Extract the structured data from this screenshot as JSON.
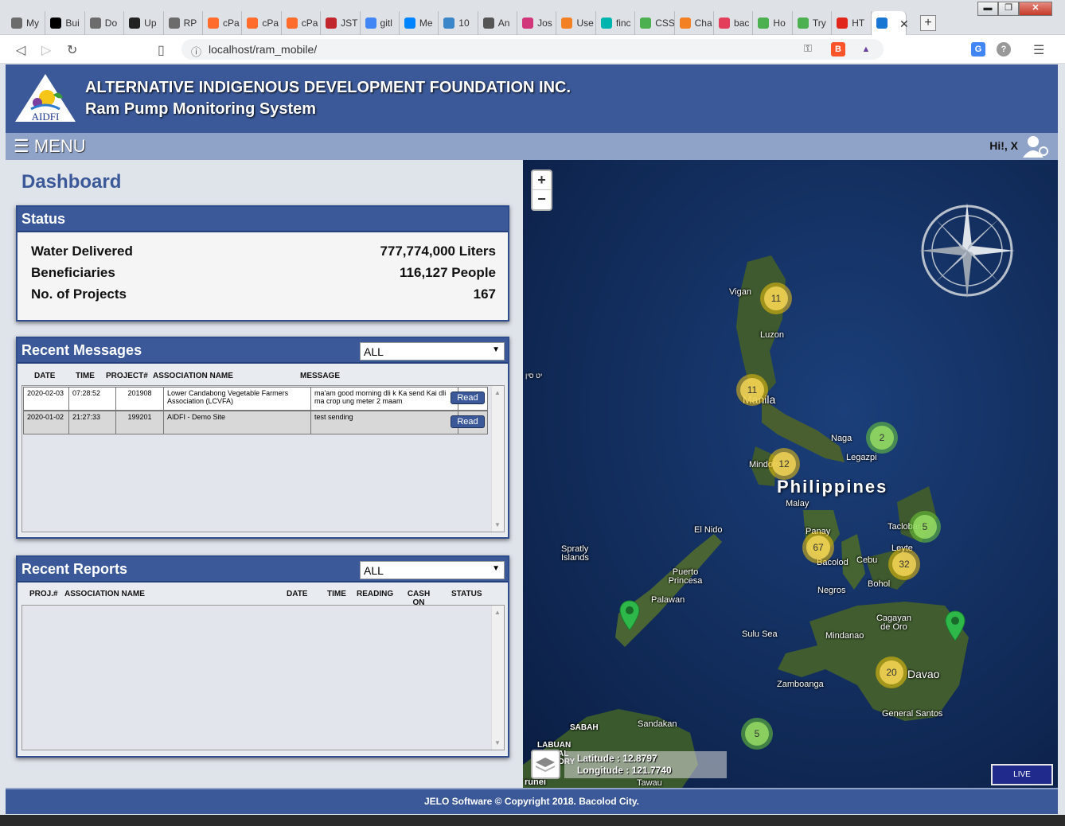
{
  "browser": {
    "tabs": [
      {
        "label": "My",
        "icon": "globe-icon",
        "color": "#6c6c6c"
      },
      {
        "label": "Bui",
        "icon": "medium-icon",
        "color": "#000000"
      },
      {
        "label": "Do",
        "icon": "globe-icon",
        "color": "#6c6c6c"
      },
      {
        "label": "Up",
        "icon": "github-icon",
        "color": "#222222"
      },
      {
        "label": "RP",
        "icon": "globe-icon",
        "color": "#6c6c6c"
      },
      {
        "label": "cPa",
        "icon": "cpanel-icon",
        "color": "#ff6c2c"
      },
      {
        "label": "cPa",
        "icon": "cpanel-icon",
        "color": "#ff6c2c"
      },
      {
        "label": "cPa",
        "icon": "cpanel-icon",
        "color": "#ff6c2c"
      },
      {
        "label": "JST",
        "icon": "store-icon",
        "color": "#c2272d"
      },
      {
        "label": "gitl",
        "icon": "google-icon",
        "color": "#4285f4"
      },
      {
        "label": "Me",
        "icon": "messenger-icon",
        "color": "#0084ff"
      },
      {
        "label": "10",
        "icon": "gear-icon",
        "color": "#3a86c8"
      },
      {
        "label": "An",
        "icon": "code-icon",
        "color": "#555555"
      },
      {
        "label": "Jos",
        "icon": "jsfiddle-icon",
        "color": "#d1357a"
      },
      {
        "label": "Use",
        "icon": "stackoverflow-icon",
        "color": "#f48024"
      },
      {
        "label": "finc",
        "icon": "diamond-icon",
        "color": "#00b5ad"
      },
      {
        "label": "CSS",
        "icon": "w3-icon",
        "color": "#4caf50"
      },
      {
        "label": "Cha",
        "icon": "stackoverflow-icon",
        "color": "#f48024"
      },
      {
        "label": "bac",
        "icon": "flower-icon",
        "color": "#e43f5a"
      },
      {
        "label": "Ho",
        "icon": "w3-icon",
        "color": "#4caf50"
      },
      {
        "label": "Try",
        "icon": "w3-icon",
        "color": "#4caf50"
      },
      {
        "label": "HT",
        "icon": "opera-icon",
        "color": "#e1261c"
      },
      {
        "label": "",
        "icon": "music-icon",
        "color": "#1976d2"
      }
    ],
    "url": "localhost/ram_mobile/",
    "new_tab": "+",
    "close_tab": "✕"
  },
  "header": {
    "logo_text": "AIDFI",
    "org_name": "ALTERNATIVE INDIGENOUS DEVELOPMENT FOUNDATION INC.",
    "system_name": "Ram Pump Monitoring System"
  },
  "menubar": {
    "menu_label": "☰ MENU",
    "greeting": "Hi!, X"
  },
  "dashboard": {
    "title": "Dashboard",
    "status": {
      "title": "Status",
      "rows": [
        {
          "label": "Water Delivered",
          "value": "777,774,000 Liters"
        },
        {
          "label": "Beneficiaries",
          "value": "116,127 People"
        },
        {
          "label": "No. of Projects",
          "value": "167"
        }
      ]
    },
    "messages": {
      "title": "Recent Messages",
      "filter": "ALL",
      "headers": [
        "DATE",
        "TIME",
        "PROJECT#",
        "ASSOCIATION NAME",
        "MESSAGE"
      ],
      "rows": [
        {
          "date": "2020-02-03",
          "time": "07:28:52",
          "project": "201908",
          "association": "Lower Candabong Vegetable Farmers Association (LCVFA)",
          "message": "ma'am good morning dli k Ka send Kai dli ma crop ung meter 2 maam",
          "action": "Read"
        },
        {
          "date": "2020-01-02",
          "time": "21:27:33",
          "project": "199201",
          "association": "AIDFI - Demo Site",
          "message": "test sending",
          "action": "Read"
        }
      ]
    },
    "reports": {
      "title": "Recent Reports",
      "filter": "ALL",
      "headers": [
        "PROJ.#",
        "ASSOCIATION NAME",
        "DATE",
        "TIME",
        "READING",
        "CASH ON HAND",
        "STATUS"
      ]
    }
  },
  "map": {
    "zoom_in": "+",
    "zoom_out": "−",
    "country": "Philippines",
    "places": [
      "Vigan",
      "Luzon",
      "Manila",
      "Naga",
      "Legazpi",
      "Mindoro",
      "Malay",
      "El Nido",
      "Panay",
      "Tacloban",
      "Leyte",
      "Spratly Islands",
      "Puerto Princesa",
      "Bacolod",
      "Cebu",
      "Bohol",
      "Palawan",
      "Negros",
      "Cagayan de Oro",
      "Sulu Sea",
      "Mindanao",
      "Davao",
      "Zamboanga",
      "General Santos",
      "SABAH",
      "Sandakan",
      "LABUAN",
      "Tawau",
      "יט סין"
    ],
    "clusters": [
      {
        "count": "11",
        "kind": "yellow"
      },
      {
        "count": "11",
        "kind": "yellow"
      },
      {
        "count": "2",
        "kind": "green"
      },
      {
        "count": "12",
        "kind": "yellow"
      },
      {
        "count": "5",
        "kind": "green"
      },
      {
        "count": "67",
        "kind": "yellow"
      },
      {
        "count": "32",
        "kind": "yellow"
      },
      {
        "count": "20",
        "kind": "yellow"
      },
      {
        "count": "5",
        "kind": "green"
      }
    ],
    "latitude_label": "Latitude : 12.8797",
    "longitude_label": "Longitude : 121.7740",
    "live_label": "LIVE",
    "partial_labels": [
      "AL",
      "ORY",
      "runei"
    ]
  },
  "footer": {
    "text": "JELO Software © Copyright 2018. Bacolod City."
  }
}
